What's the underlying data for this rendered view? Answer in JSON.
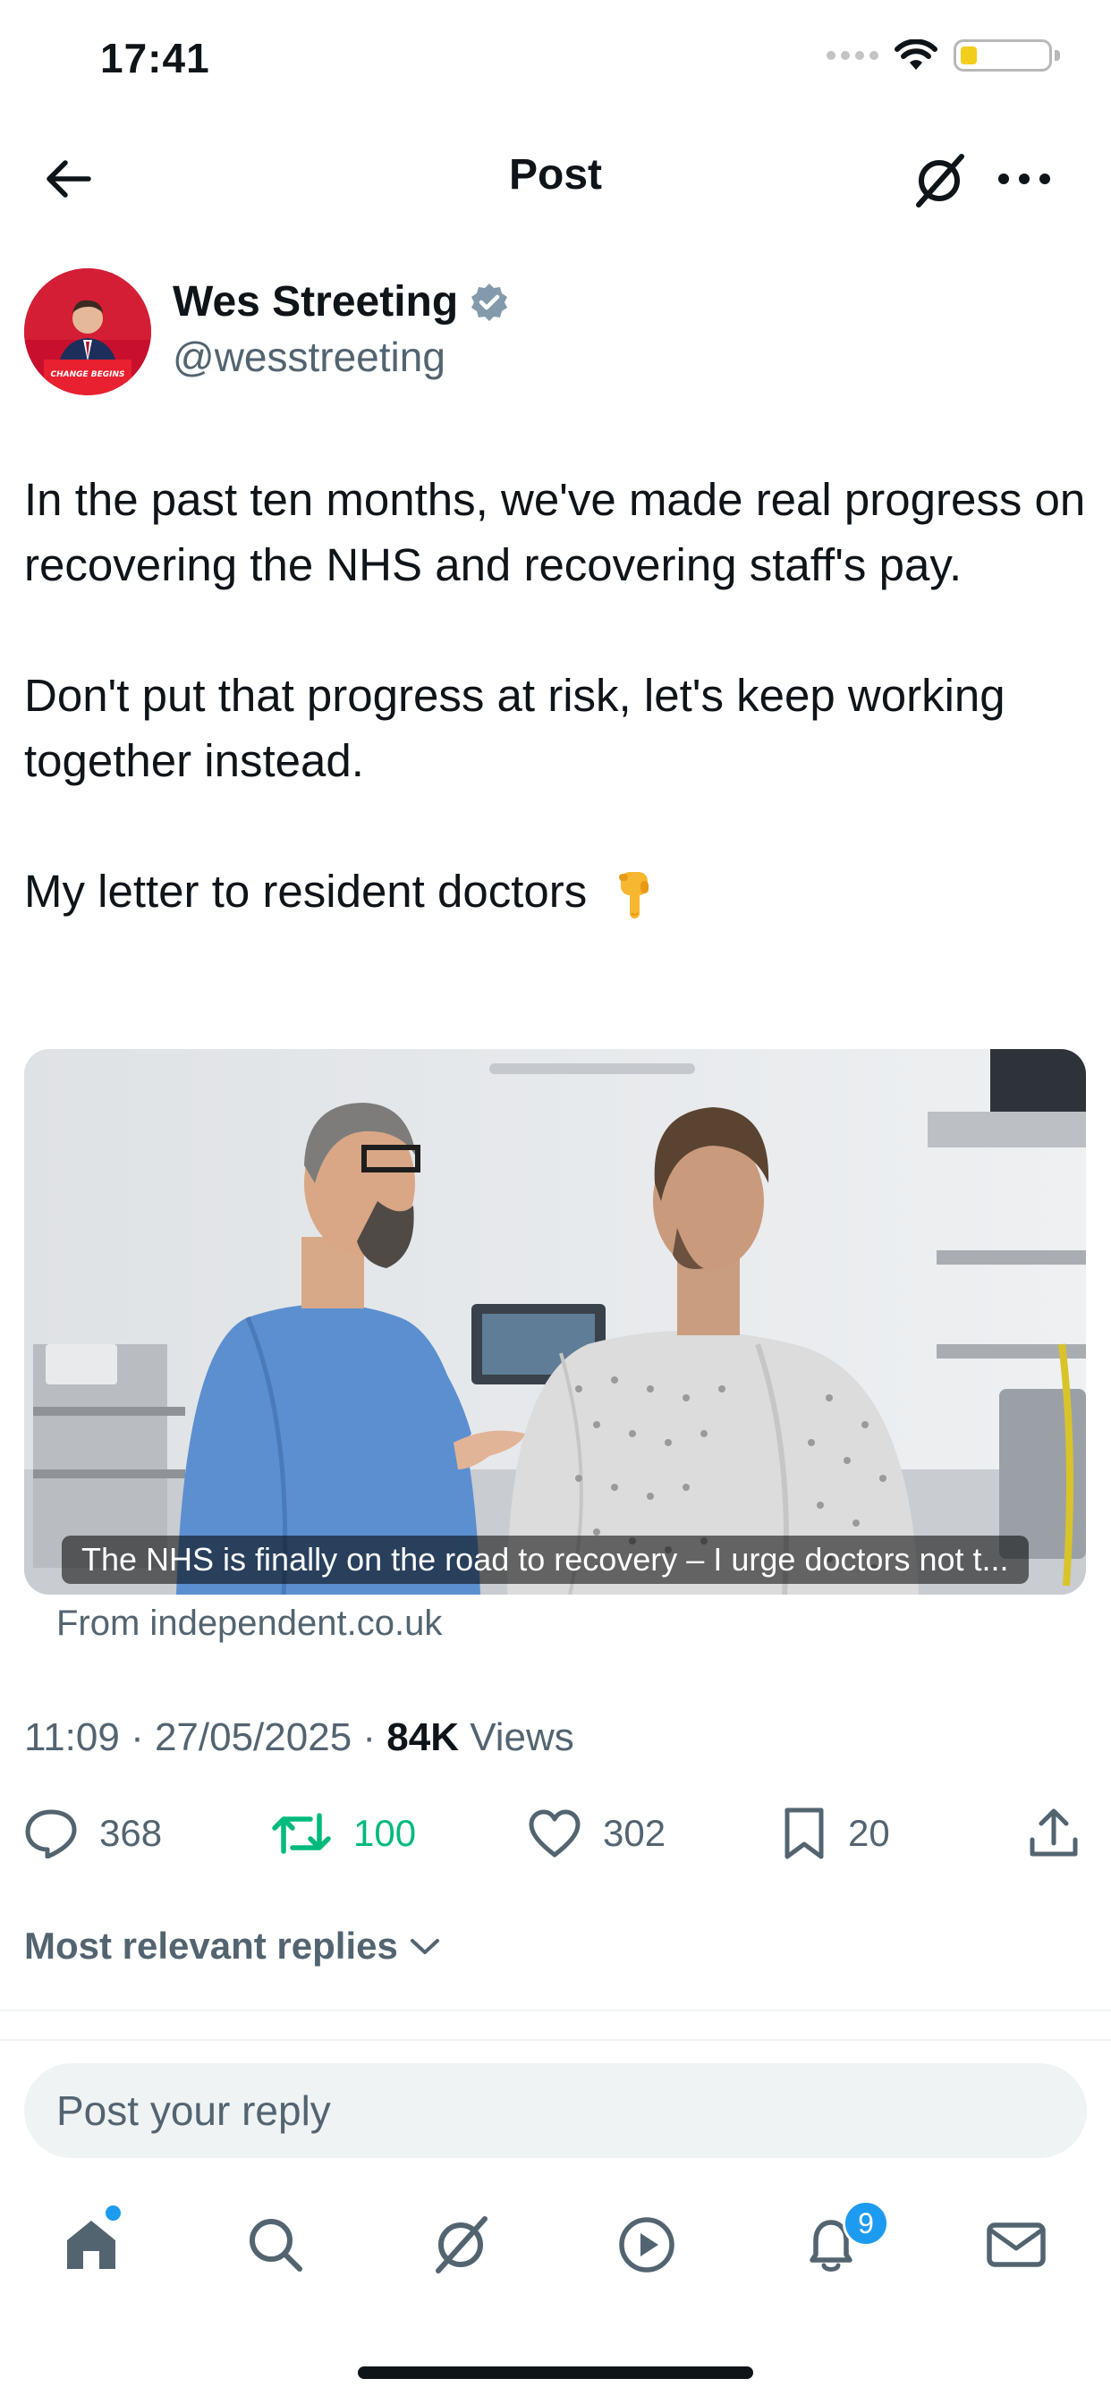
{
  "status_bar": {
    "time": "17:41"
  },
  "header": {
    "title": "Post"
  },
  "author": {
    "name": "Wes Streeting",
    "handle": "@wesstreeting",
    "avatar_podium_text": "CHANGE BEGINS"
  },
  "post": {
    "paragraphs": [
      "In the past ten months, we've made real progress on recovering the NHS and recovering staff's pay.",
      "Don't put that progress at risk, let's keep working together instead."
    ],
    "last_line": "My letter to resident doctors",
    "emoji": "pointing-down-hand"
  },
  "link_card": {
    "caption": "The NHS is finally on the road to recovery – I urge doctors not t...",
    "source": "From independent.co.uk"
  },
  "meta": {
    "time_date": "11:09 · 27/05/2025 · ",
    "views_count": "84K",
    "views_label": " Views"
  },
  "actions": {
    "replies": "368",
    "reposts": "100",
    "likes": "302",
    "bookmarks": "20"
  },
  "replies_sort": {
    "label": "Most relevant replies"
  },
  "reply_box": {
    "placeholder": "Post your reply"
  },
  "nav": {
    "notifications_badge": "9"
  },
  "colors": {
    "accent": "#1d9bf0",
    "repost_active": "#00ba7c",
    "secondary_text": "#536471",
    "verified_badge": "#829aab"
  }
}
